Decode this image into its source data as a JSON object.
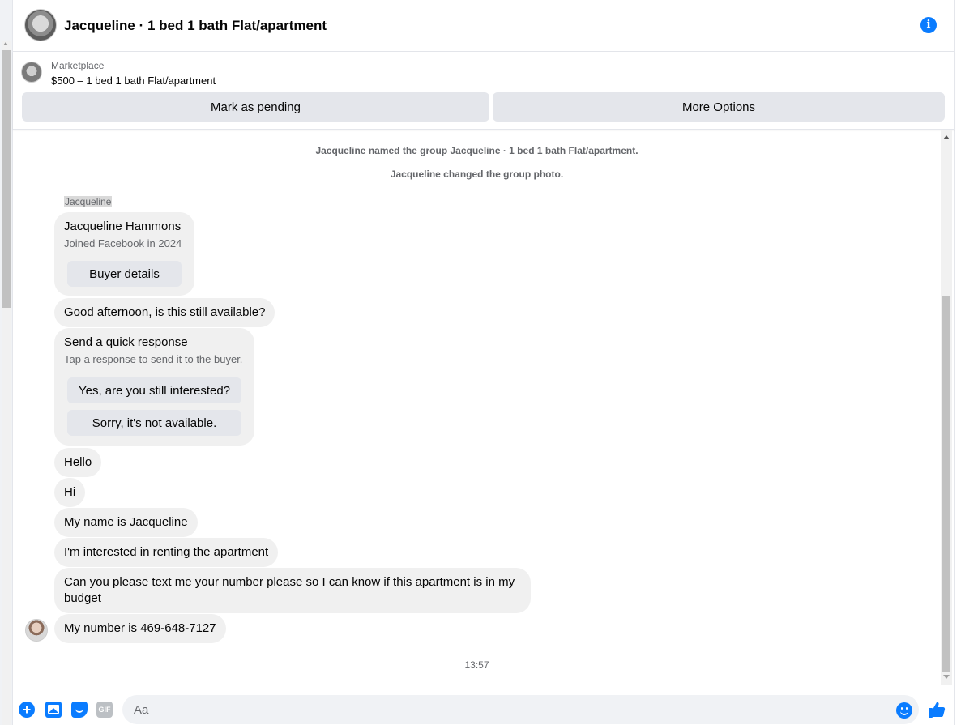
{
  "header": {
    "title": "Jacqueline · 1 bed 1 bath Flat/apartment",
    "info_icon": "info-icon",
    "info_glyph": "i"
  },
  "listing": {
    "kind": "Marketplace",
    "price_title": "$500 – 1 bed 1 bath Flat/apartment",
    "mark_pending_label": "Mark as pending",
    "more_options_label": "More Options"
  },
  "chat": {
    "system_messages": [
      "Jacqueline named the group Jacqueline · 1 bed 1 bath Flat/apartment.",
      "Jacqueline changed the group photo."
    ],
    "sender_name": "Jacqueline",
    "profile_card": {
      "name": "Jacqueline Hammons",
      "joined": "Joined Facebook in 2024",
      "button_label": "Buyer details"
    },
    "messages": [
      "Good afternoon, is this still available?",
      "Hello",
      "Hi",
      "My name is Jacqueline",
      "I'm interested in renting the apartment",
      "Can you please text me your number please so I can know if this apartment is in my budget",
      "My number is 469-648-7127"
    ],
    "quick_response": {
      "title": "Send a quick response",
      "subtitle": "Tap a response to send it to the buyer.",
      "options": [
        "Yes, are you still interested?",
        "Sorry, it's not available."
      ]
    },
    "timestamp": "13:57"
  },
  "composer": {
    "placeholder": "Aa",
    "gif_label": "GIF",
    "plus_glyph": "+",
    "icons": [
      "plus-icon",
      "photo-icon",
      "sticker-icon",
      "gif-icon",
      "emoji-icon",
      "like-icon"
    ]
  },
  "colors": {
    "accent": "#0a7cff",
    "bubble": "#f0f0f0",
    "secondary_text": "#65676b",
    "button_bg": "#e4e6eb"
  }
}
